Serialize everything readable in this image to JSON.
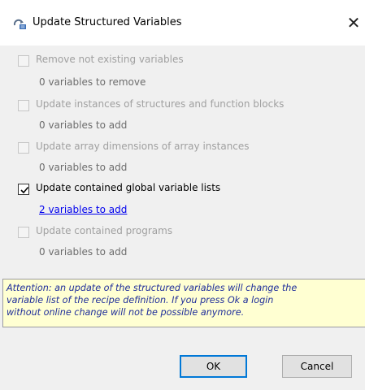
{
  "dialog": {
    "title": "Update Structured Variables",
    "close_symbol": "✕",
    "title_icon": "recipe-update-icon"
  },
  "options": [
    {
      "label": "Remove not existing variables",
      "checked": false,
      "enabled": false,
      "detail": "0 variables to remove",
      "detail_is_link": false
    },
    {
      "label": "Update instances of structures and function blocks",
      "checked": false,
      "enabled": false,
      "detail": "0 variables to add",
      "detail_is_link": false
    },
    {
      "label": "Update array dimensions of array instances",
      "checked": false,
      "enabled": false,
      "detail": "0 variables to add",
      "detail_is_link": false
    },
    {
      "label": "Update contained global variable lists",
      "checked": true,
      "enabled": true,
      "detail": "2 variables to add",
      "detail_is_link": true
    },
    {
      "label": "Update contained programs",
      "checked": false,
      "enabled": false,
      "detail": "0 variables to add",
      "detail_is_link": false
    }
  ],
  "attention": {
    "line1": "Attention: an update of the structured variables will change the",
    "line2": "variable list of the recipe definition. If you press Ok  a login",
    "line3": "without online change will not be possible anymore."
  },
  "buttons": {
    "ok": "OK",
    "cancel": "Cancel"
  },
  "colors": {
    "attention_background": "#ffffd2",
    "attention_text": "#1f2e9a",
    "link": "#0000ee",
    "default_button_border": "#0078d7"
  }
}
